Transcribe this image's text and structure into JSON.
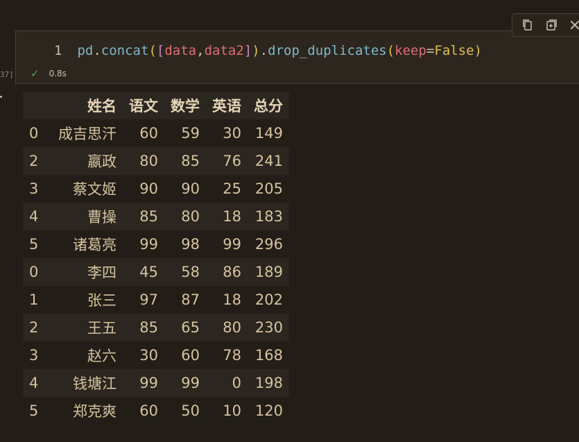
{
  "cell": {
    "execution_count": "37]",
    "line_number": "1",
    "code": {
      "t1": "pd",
      "t2": ".",
      "t3": "concat",
      "t4": "(",
      "t5": "[",
      "t6": "data",
      "t7": ",",
      "t8": "data2",
      "t9": "]",
      "t10": ")",
      "t11": ".",
      "t12": "drop_duplicates",
      "t13": "(",
      "t14": "keep",
      "t15": "=",
      "t16": "False",
      "t17": ")"
    },
    "status_time": "0.8s"
  },
  "toolbar": {
    "icons": [
      "copy-icon",
      "split-cell-icon",
      "close-icon"
    ],
    "close_glyph": "×"
  },
  "table": {
    "headers": [
      "",
      "姓名",
      "语文",
      "数学",
      "英语",
      "总分"
    ],
    "rows": [
      [
        "0",
        "成吉思汗",
        "60",
        "59",
        "30",
        "149"
      ],
      [
        "2",
        "嬴政",
        "80",
        "85",
        "76",
        "241"
      ],
      [
        "3",
        "蔡文姬",
        "90",
        "90",
        "25",
        "205"
      ],
      [
        "4",
        "曹操",
        "85",
        "80",
        "18",
        "183"
      ],
      [
        "5",
        "诸葛亮",
        "99",
        "98",
        "99",
        "296"
      ],
      [
        "0",
        "李四",
        "45",
        "58",
        "86",
        "189"
      ],
      [
        "1",
        "张三",
        "97",
        "87",
        "18",
        "202"
      ],
      [
        "2",
        "王五",
        "85",
        "65",
        "80",
        "230"
      ],
      [
        "3",
        "赵六",
        "30",
        "60",
        "78",
        "168"
      ],
      [
        "4",
        "钱塘江",
        "99",
        "99",
        "0",
        "198"
      ],
      [
        "5",
        "郑克爽",
        "60",
        "50",
        "10",
        "120"
      ]
    ]
  }
}
